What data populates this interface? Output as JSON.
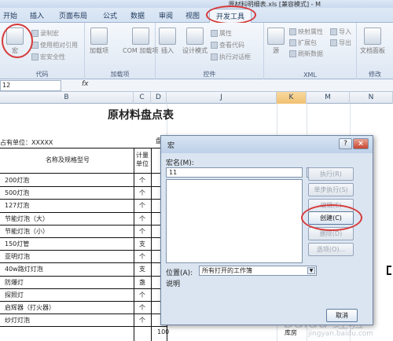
{
  "window": {
    "title": "原材料明细表.xls [兼容模式] - M"
  },
  "tabs": [
    "开始",
    "插入",
    "页面布局",
    "公式",
    "数据",
    "审阅",
    "视图",
    "开发工具"
  ],
  "ribbon": {
    "code": {
      "macro": "宏",
      "record": "录制宏",
      "relative": "使用相对引用",
      "security": "宏安全性",
      "label": "代码"
    },
    "addins": {
      "addins": "加载项",
      "com": "COM 加载项",
      "label": "加载项"
    },
    "controls": {
      "insert": "插入",
      "design": "设计模式",
      "props": "属性",
      "viewcode": "查看代码",
      "dialog": "执行对话框",
      "label": "控件"
    },
    "xml": {
      "source": "源",
      "mapprops": "映射属性",
      "expand": "扩展包",
      "refresh": "刷新数据",
      "import": "导入",
      "export": "导出",
      "label": "XML"
    },
    "modify": {
      "docpanel": "文档面板",
      "label": "修改"
    }
  },
  "formula": {
    "namebox": "12",
    "fx": "fx"
  },
  "columns": [
    "B",
    "C",
    "D",
    "J",
    "K",
    "M",
    "N"
  ],
  "sheet": {
    "title": "原材料盘点表",
    "unit": "占有单位：XXXXX",
    "header_name": "名称及规格型号",
    "header_unit": "计量\n单位",
    "d_top": "盘",
    "rows": [
      {
        "name": "200灯泡",
        "unit": "个"
      },
      {
        "name": "500灯泡",
        "unit": "个"
      },
      {
        "name": "127灯泡",
        "unit": "个"
      },
      {
        "name": "节能灯泡（大）",
        "unit": "个"
      },
      {
        "name": "节能灯泡（小）",
        "unit": "个"
      },
      {
        "name": "150灯管",
        "unit": "支"
      },
      {
        "name": "亚明灯泡",
        "unit": "个"
      },
      {
        "name": "40w路灯灯泡",
        "unit": "支"
      },
      {
        "name": "防爆灯",
        "unit": "盏"
      },
      {
        "name": "探照灯",
        "unit": "个"
      },
      {
        "name": "启辉器（打火器）",
        "unit": "个"
      },
      {
        "name": "纱灯灯泡",
        "unit": "个"
      }
    ],
    "last_d": "100",
    "k_text": "库房"
  },
  "dialog": {
    "title": "宏",
    "name_label": "宏名(M):",
    "name_value": "11",
    "btn_run": "执行(R)",
    "btn_step": "单步执行(S)",
    "btn_edit": "编辑(E)",
    "btn_create": "创建(C)",
    "btn_delete": "删除(D)",
    "btn_options": "选项(O)...",
    "location_label": "位置(A):",
    "location_value": "所有打开的工作簿",
    "description_label": "说明",
    "btn_cancel": "取消"
  },
  "watermark": "Baidu 经验",
  "watermark_url": "jingyan.baidu.com"
}
